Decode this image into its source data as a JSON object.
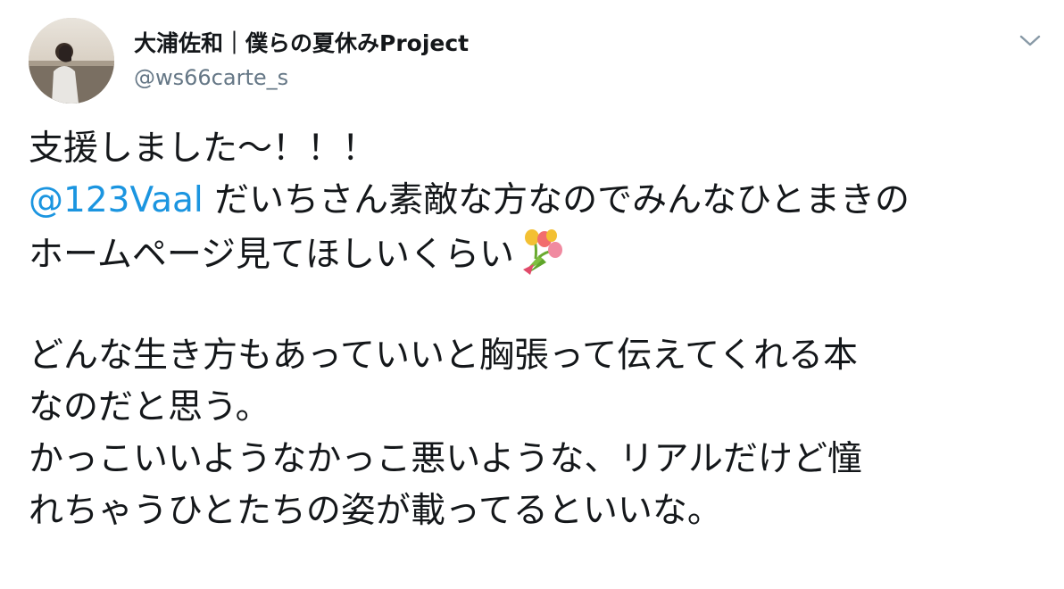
{
  "author": {
    "display_name": "大浦佐和｜僕らの夏休みProject",
    "handle": "@ws66carte_s",
    "avatar_icon": "profile-photo-avatar"
  },
  "menu": {
    "icon": "chevron-down-icon"
  },
  "tweet": {
    "line1": "支援しました〜！！！",
    "mention": "@123Vaal",
    "line2_rest": " だいちさん素敵な方なのでみんなひとまきの",
    "line3": "ホームページ見てほしいくらい",
    "line3_emoji": "bouquet-icon",
    "line4": "どんな生き方もあっていいと胸張って伝えてくれる本",
    "line5": "なのだと思う。",
    "line6": "かっこいいようなかっこ悪いような、リアルだけど憧",
    "line7": "れちゃうひとたちの姿が載ってるといいな。"
  },
  "colors": {
    "text": "#14171a",
    "secondary": "#657786",
    "link": "#1b95e0"
  }
}
